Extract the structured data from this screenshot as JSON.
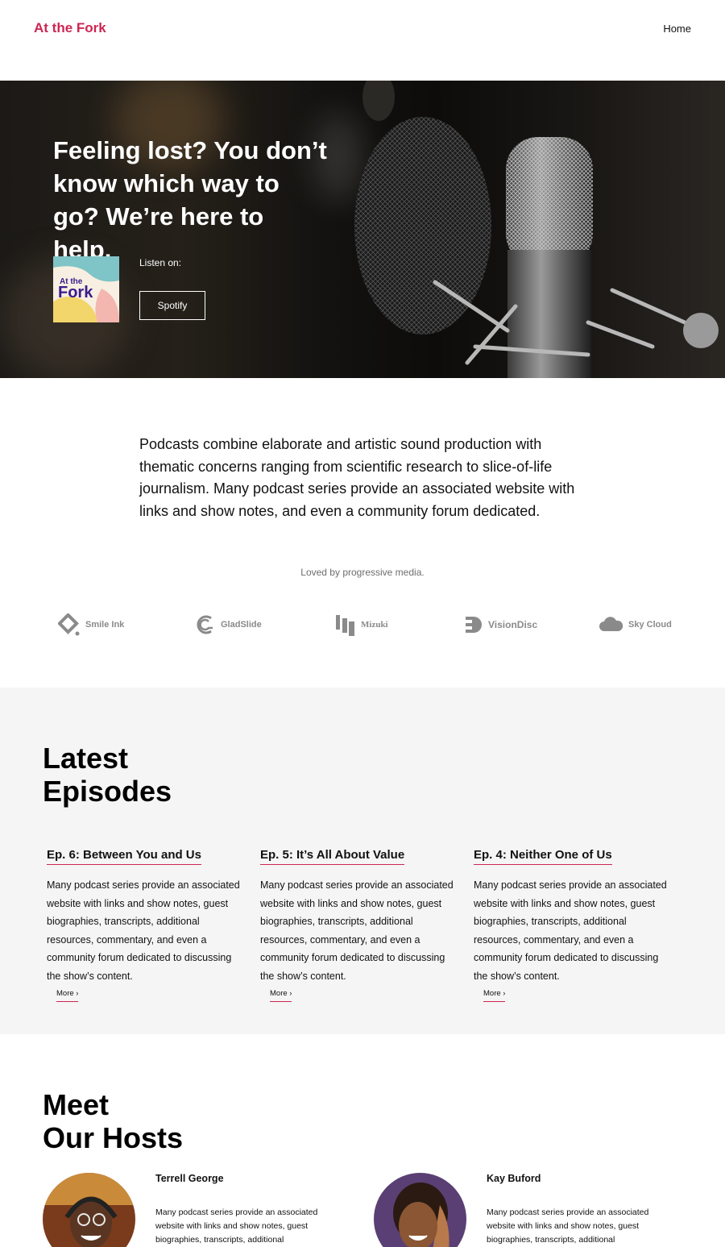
{
  "header": {
    "site_title": "At the Fork",
    "nav": [
      {
        "label": "Home"
      }
    ]
  },
  "hero": {
    "title": "Feeling lost? You don’t know which way to go? We’re here to help.",
    "cover_art_text": [
      "At the",
      "Fork"
    ],
    "listen_label": "Listen on:",
    "spotify_button": "Spotify"
  },
  "intro": {
    "text": "Podcasts combine elaborate and artistic sound production with thematic concerns ranging from scientific research to slice-of-life journalism. Many podcast series provide an associated website with links and show notes, and even a community forum dedicated."
  },
  "press": {
    "label": "Loved by progressive media.",
    "logos": [
      {
        "name": "Smile Ink",
        "icon": "diamond-icon"
      },
      {
        "name": "GladSlide",
        "icon": "c-swirl-icon"
      },
      {
        "name": "Mizuki",
        "icon": "m-bars-icon"
      },
      {
        "name": "VisionDisc",
        "icon": "disc-icon"
      },
      {
        "name": "Sky Cloud",
        "icon": "cloud-icon"
      }
    ]
  },
  "episodes": {
    "heading_line1": "Latest",
    "heading_line2": "Episodes",
    "items": [
      {
        "title": "Ep. 6: Between You and Us",
        "desc": "Many podcast series provide an associated website with links and show notes, guest biographies, transcripts, additional resources, commentary, and even a community forum dedicated to discussing the show’s content.",
        "more": "More ›"
      },
      {
        "title": "Ep. 5: It’s All About Value",
        "desc": "Many podcast series provide an associated website with links and show notes, guest biographies, transcripts, additional resources, commentary, and even a community forum dedicated to discussing the show’s content.",
        "more": "More ›"
      },
      {
        "title": "Ep. 4: Neither One of Us",
        "desc": "Many podcast series provide an associated website with links and show notes, guest biographies, transcripts, additional resources, commentary, and even a community forum dedicated to discussing the show’s content.",
        "more": "More ›"
      }
    ]
  },
  "hosts": {
    "heading_line1": "Meet",
    "heading_line2": "Our Hosts",
    "items": [
      {
        "name": "Terrell George",
        "bio": "Many podcast series provide an associated website with links and show notes, guest biographies, transcripts, additional resources,"
      },
      {
        "name": "Kay Buford",
        "bio": "Many podcast series provide an associated website with links and show notes, guest biographies, transcripts, additional resources,"
      }
    ]
  },
  "colors": {
    "accent": "#cd2653",
    "episodes_bg": "#f5f5f5",
    "text": "#111111",
    "muted": "#6d6d6d"
  }
}
